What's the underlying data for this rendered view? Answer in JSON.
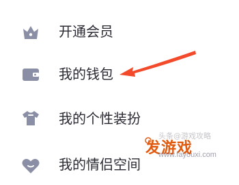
{
  "menu": {
    "items": [
      {
        "label": "开通会员",
        "icon": "crown-icon"
      },
      {
        "label": "我的钱包",
        "icon": "wallet-icon"
      },
      {
        "label": "我的个性装扮",
        "icon": "shirt-icon"
      },
      {
        "label": "我的情侣空间",
        "icon": "heart-icon"
      }
    ],
    "icon_color": "#8a8fa6"
  },
  "annotation": {
    "arrow_color": "#f24a2a"
  },
  "watermark": {
    "text": "头条@游戏攻略",
    "brand": "发游戏",
    "url": "www.fayouxi.com"
  }
}
